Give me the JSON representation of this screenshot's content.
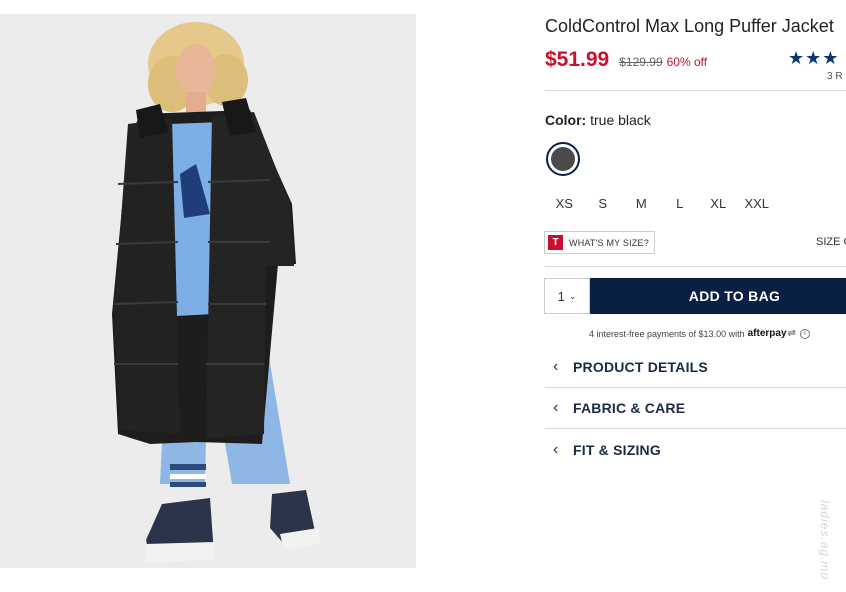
{
  "product": {
    "title": "ColdControl Max Long Puffer Jacket",
    "price_now": "$51.99",
    "price_was": "$129.99",
    "discount": "60% off",
    "stars": "★★★",
    "reviews": "3 R"
  },
  "color": {
    "label": "Color:",
    "value": "true black",
    "swatch_color": "#4a4a4a"
  },
  "sizes": [
    "XS",
    "S",
    "M",
    "L",
    "XL",
    "XXL"
  ],
  "fit": {
    "badge": "T",
    "whats_my_size": "WHAT'S MY SIZE?",
    "size_chart": "SIZE C"
  },
  "cart": {
    "quantity": "1",
    "add_to_bag": "ADD TO BAG"
  },
  "afterpay": {
    "text": "4 interest-free payments of $13.00 with",
    "brand": "afterpay",
    "info": "i"
  },
  "accordions": [
    {
      "label": "PRODUCT DETAILS"
    },
    {
      "label": "FABRIC & CARE"
    },
    {
      "label": "FIT & SIZING"
    }
  ],
  "watermark": "ladies.ag.mo",
  "colors": {
    "accent_red": "#c8102e",
    "navy": "#0a1f44"
  }
}
